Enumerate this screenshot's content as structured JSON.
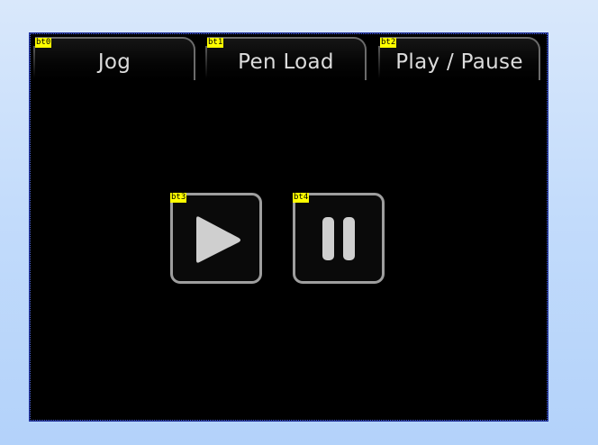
{
  "tabs": [
    {
      "id": "bt0",
      "label": "Jog"
    },
    {
      "id": "bt1",
      "label": "Pen Load"
    },
    {
      "id": "bt2",
      "label": "Play / Pause"
    }
  ],
  "controls": {
    "play": {
      "id": "bt3",
      "icon": "play-icon"
    },
    "pause": {
      "id": "bt4",
      "icon": "pause-icon"
    }
  },
  "colors": {
    "screen_background": "#000000",
    "screen_border": "#1d2f9b",
    "tab_text": "#dcdcdc",
    "button_border": "#9e9e9e",
    "icon_fill": "#cfcfcf",
    "id_tag_background": "#ffff00"
  }
}
